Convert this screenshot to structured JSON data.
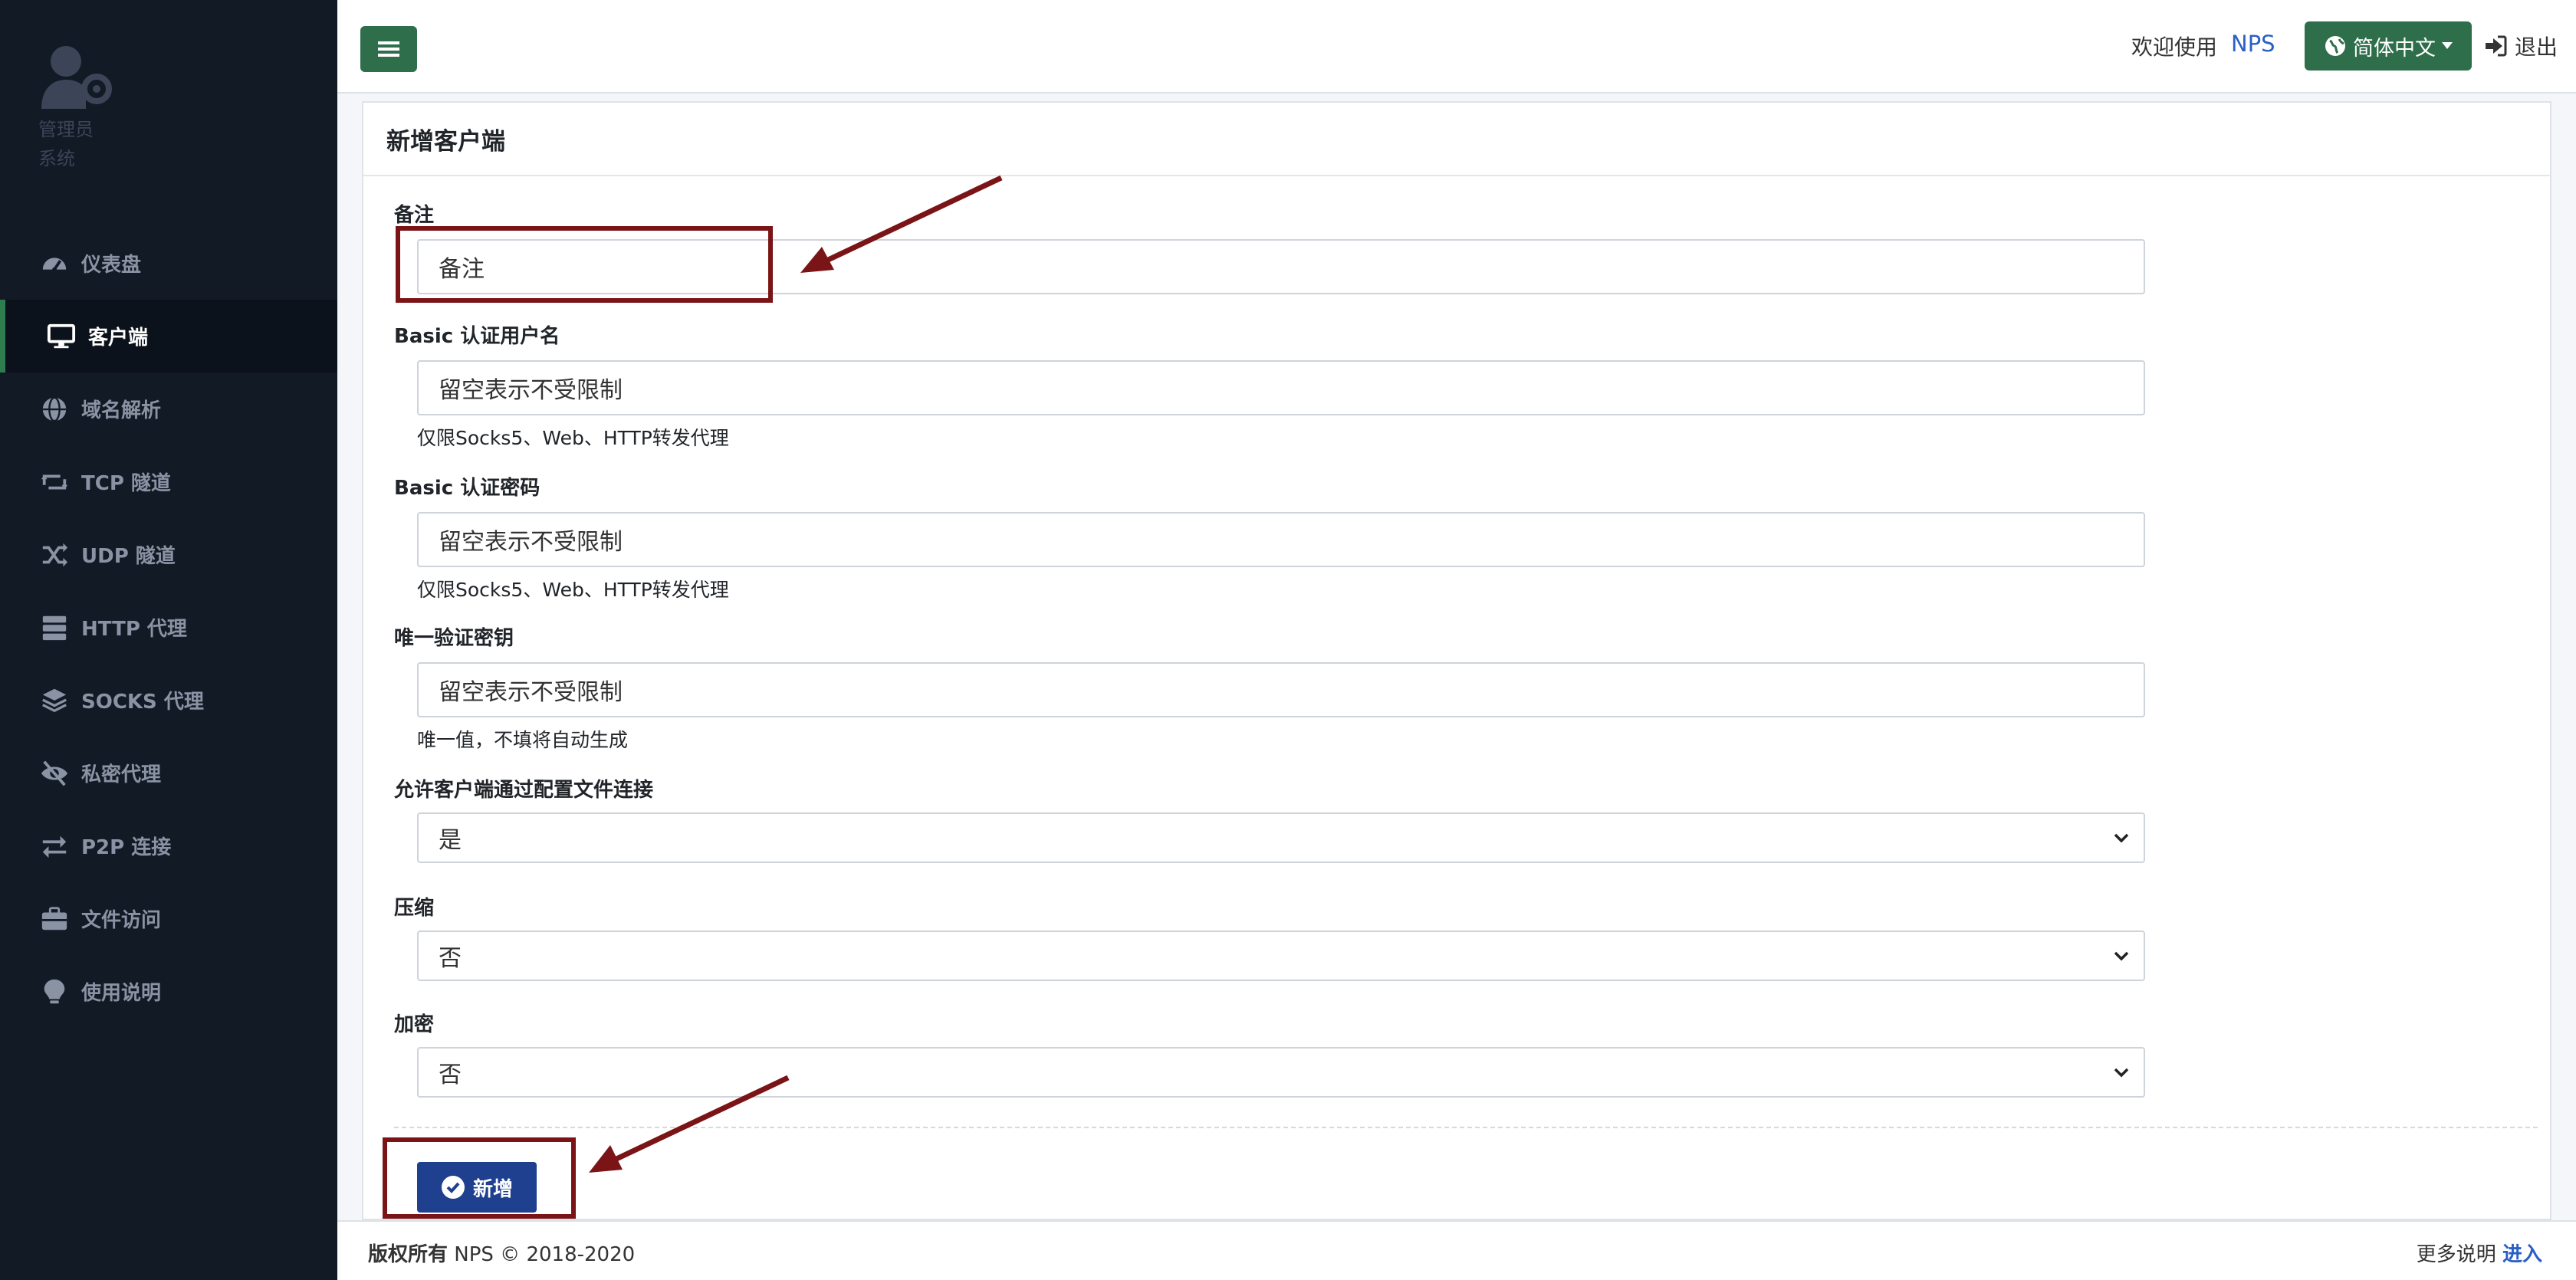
{
  "sidebar": {
    "user_role": "管理员",
    "user_system": "系统",
    "items": [
      {
        "label": "仪表盘",
        "icon": "dashboard-icon"
      },
      {
        "label": "客户端",
        "icon": "desktop-icon",
        "active": true
      },
      {
        "label": "域名解析",
        "icon": "globe-icon"
      },
      {
        "label": "TCP 隧道",
        "icon": "retweet-icon"
      },
      {
        "label": "UDP 隧道",
        "icon": "random-icon"
      },
      {
        "label": "HTTP 代理",
        "icon": "server-icon"
      },
      {
        "label": "SOCKS 代理",
        "icon": "layers-icon"
      },
      {
        "label": "私密代理",
        "icon": "eye-slash-icon"
      },
      {
        "label": "P2P 连接",
        "icon": "exchange-icon"
      },
      {
        "label": "文件访问",
        "icon": "briefcase-icon"
      },
      {
        "label": "使用说明",
        "icon": "lightbulb-icon"
      }
    ]
  },
  "topbar": {
    "welcome": "欢迎使用",
    "brand": "NPS",
    "language": "简体中文",
    "logout": "退出"
  },
  "card": {
    "title": "新增客户端"
  },
  "form": {
    "remark_label": "备注",
    "remark_placeholder": "备注",
    "basic_user_label": "Basic 认证用户名",
    "basic_user_placeholder": "留空表示不受限制",
    "basic_user_help": "仅限Socks5、Web、HTTP转发代理",
    "basic_pass_label": "Basic 认证密码",
    "basic_pass_placeholder": "留空表示不受限制",
    "basic_pass_help": "仅限Socks5、Web、HTTP转发代理",
    "vkey_label": "唯一验证密钥",
    "vkey_placeholder": "留空表示不受限制",
    "vkey_help": "唯一值，不填将自动生成",
    "config_conn_label": "允许客户端通过配置文件连接",
    "config_conn_value": "是",
    "compress_label": "压缩",
    "compress_value": "否",
    "crypt_label": "加密",
    "crypt_value": "否",
    "submit_label": "新增"
  },
  "footer": {
    "copyright_bold": "版权所有",
    "copyright_text": "NPS © 2018-2020",
    "more": "更多说明",
    "enter": "进入"
  },
  "colors": {
    "sidebar_bg": "#121a26",
    "accent_green": "#2f6e4b",
    "submit_blue": "#1f3f8f",
    "annotation_red": "#7a1416",
    "link_blue": "#2a5fc6"
  }
}
